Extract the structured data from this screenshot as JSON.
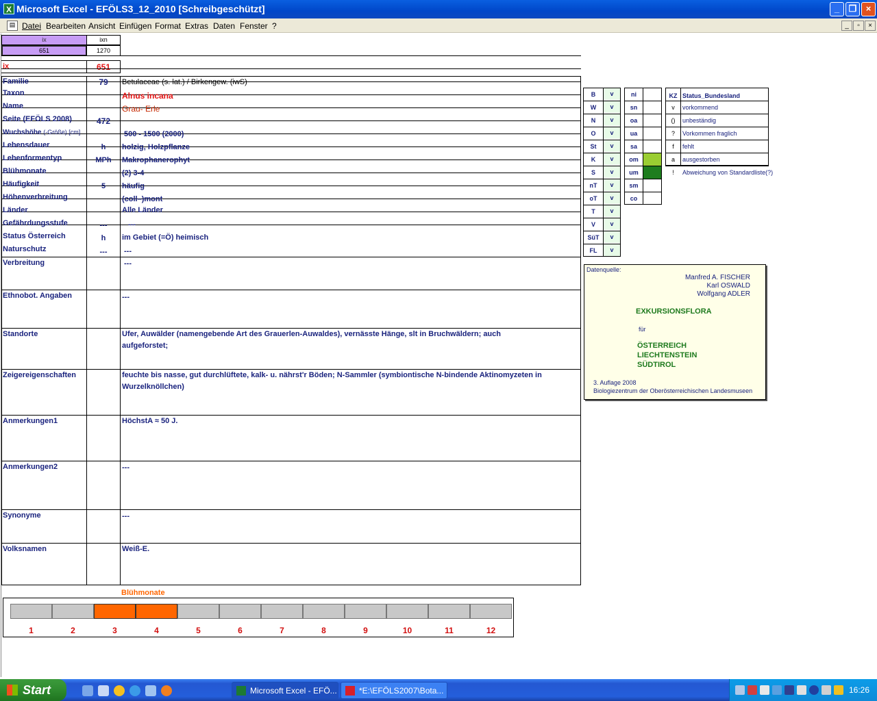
{
  "window": {
    "title": "Microsoft Excel - EFÖLS3_12_2010  [Schreibgeschützt]",
    "app_icon": "X"
  },
  "menu": [
    "Datei",
    "Bearbeiten",
    "Ansicht",
    "Einfügen",
    "Format",
    "Extras",
    "Daten",
    "Fenster",
    "?"
  ],
  "doc_buttons": [
    "_",
    "▫",
    "×"
  ],
  "index": {
    "ix_header": "ix",
    "ixn_header": "ixn",
    "ix_value": "651",
    "ixn_value": "1270",
    "ix_label": "ix",
    "ix_big": "651"
  },
  "colors": {
    "title_blue": "#0047c9",
    "label_navy": "#1a237e",
    "taxon_red": "#e31414",
    "name_red": "#c62800",
    "bloom_orange": "#ff6600",
    "purple_cell": "#c79cf5",
    "status_green_light": "#9acd32",
    "status_green_dark": "#1e7d1e",
    "source_green": "#1e7a1e"
  },
  "fields": [
    {
      "label": "Familie",
      "code": "79",
      "value": "Betulaceae (s. lat.)  /  Birkengew. (iwS)"
    },
    {
      "label": "Taxon",
      "code": "",
      "value": "Alnus incana"
    },
    {
      "label": "Name",
      "code": "",
      "value": "Grau- Erle"
    },
    {
      "label": "Seite (EFÖLS 2008)",
      "code": "472",
      "value": ""
    },
    {
      "label": "Wuchshöhe",
      "label_small": "(-Größe) [cm]",
      "code": "",
      "value": "500 - 1500 (2000)"
    },
    {
      "label": "Lebensdauer",
      "code": "h",
      "value": "holzig, Holzpflanze"
    },
    {
      "label": "Lebenformentyp",
      "code": "MPh",
      "value": "Makrophanerophyt"
    },
    {
      "label": "Blühmonate",
      "code": "",
      "value": "(2) 3-4"
    },
    {
      "label": "Häufigkeit",
      "code": "5",
      "value": "häufig"
    },
    {
      "label": "Höhenverbreitung",
      "code": "",
      "value": "(coll–)mont"
    },
    {
      "label": "Länder",
      "code": "",
      "value": "Alle Länder"
    },
    {
      "label": "Gefährdungsstufe",
      "code": "---",
      "value": "---"
    },
    {
      "label": "Status Österreich",
      "code": "h",
      "value": "im Gebiet (=Ö) heimisch"
    },
    {
      "label": "Naturschutz",
      "code": "---",
      "value": "---"
    },
    {
      "label": "Verbreitung",
      "code": "",
      "value": "---"
    },
    {
      "label": "Ethnobot. Angaben",
      "code": "",
      "value": "---"
    },
    {
      "label": "Standorte",
      "code": "",
      "value": "Ufer, Auwälder (namengebende Art des Grauerlen-Auwaldes), vernässte Hänge, slt in Bruchwäldern; auch",
      "value2": "aufgeforstet;"
    },
    {
      "label": "Zeigereigenschaften",
      "code": "",
      "value": "feuchte bis nasse, gut durchlüftete, kalk- u. nährst'r Böden; N-Sammler (symbiontische N-bindende Aktinomyzeten in",
      "value2": "Wurzelknöllchen)"
    },
    {
      "label": "Anmerkungen1",
      "code": "",
      "value": "HöchstA ≈ 50 J."
    },
    {
      "label": "Anmerkungen2",
      "code": "",
      "value": "---"
    },
    {
      "label": "Synonyme",
      "code": "",
      "value": "---"
    },
    {
      "label": "Volksnamen",
      "code": "",
      "value": "Weiß-E."
    }
  ],
  "regions": [
    {
      "code": "B",
      "v": "v"
    },
    {
      "code": "W",
      "v": "v"
    },
    {
      "code": "N",
      "v": "v"
    },
    {
      "code": "O",
      "v": "v"
    },
    {
      "code": "St",
      "v": "v"
    },
    {
      "code": "K",
      "v": "v"
    },
    {
      "code": "S",
      "v": "v"
    },
    {
      "code": "nT",
      "v": "v"
    },
    {
      "code": "oT",
      "v": "v"
    },
    {
      "code": "T",
      "v": "v"
    },
    {
      "code": "V",
      "v": "v"
    },
    {
      "code": "SüT",
      "v": "v"
    },
    {
      "code": "FL",
      "v": "v"
    }
  ],
  "zones": [
    "ni",
    "sn",
    "oa",
    "ua",
    "sa",
    "om",
    "um",
    "sm",
    "co"
  ],
  "status_legend": {
    "kz_header": "KZ",
    "header": "Status_Bundesland",
    "rows": [
      {
        "kz": "v",
        "text": "vorkommend"
      },
      {
        "kz": "()",
        "text": "unbeständig"
      },
      {
        "kz": "?",
        "text": "Vorkommen fraglich"
      },
      {
        "kz": "f",
        "text": "fehlt"
      },
      {
        "kz": "a",
        "text": "ausgestorben"
      },
      {
        "kz": "!",
        "text": "Abweichung von Standardliste(?)"
      }
    ]
  },
  "quelle": {
    "label": "Datenquelle:",
    "authors": [
      "Manfred A. FISCHER",
      "Karl OSWALD",
      "Wolfgang ADLER"
    ],
    "title": "EXKURSIONSFLORA",
    "fuer": "für",
    "countries": [
      "ÖSTERREICH",
      "LIECHTENSTEIN",
      "SÜDTIROL"
    ],
    "edition": "3. Auflage 2008",
    "publisher": "Biologiezentrum der Oberösterreichischen Landesmuseen"
  },
  "bloom": {
    "title": "Blühmonate",
    "months": [
      "1",
      "2",
      "3",
      "4",
      "5",
      "6",
      "7",
      "8",
      "9",
      "10",
      "11",
      "12"
    ],
    "active": [
      0,
      0,
      1,
      1,
      0,
      0,
      0,
      0,
      0,
      0,
      0,
      0
    ]
  },
  "taskbar": {
    "start": "Start",
    "tasks": [
      "Microsoft Excel - EFÖ...",
      "*E:\\EFÖLS2007\\Bota..."
    ],
    "time": "16:26"
  }
}
